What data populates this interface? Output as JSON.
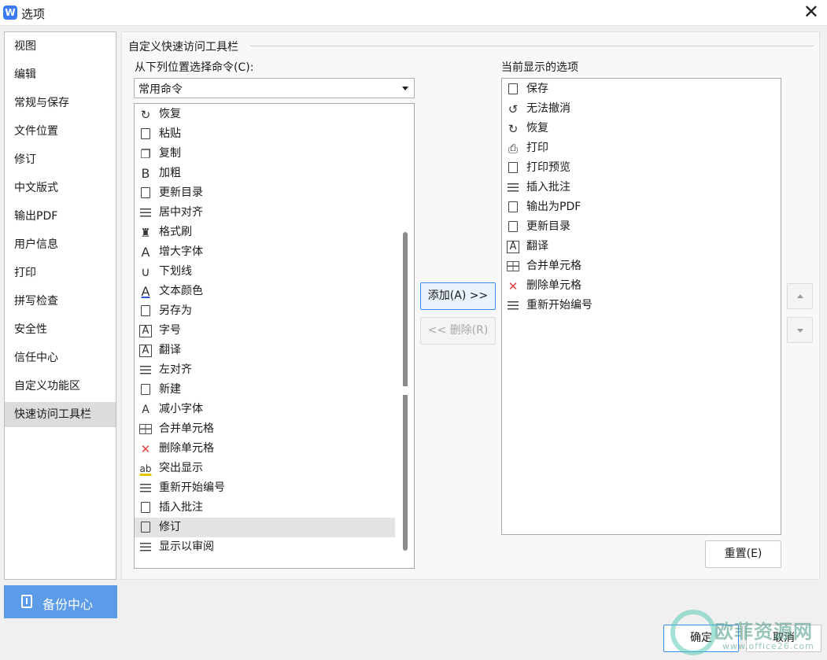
{
  "window": {
    "title": "选项",
    "app_icon_letter": "W",
    "close_glyph": "✕"
  },
  "sidebar": {
    "items": [
      {
        "label": "视图"
      },
      {
        "label": "编辑"
      },
      {
        "label": "常规与保存"
      },
      {
        "label": "文件位置"
      },
      {
        "label": "修订"
      },
      {
        "label": "中文版式"
      },
      {
        "label": "输出PDF"
      },
      {
        "label": "用户信息"
      },
      {
        "label": "打印"
      },
      {
        "label": "拼写检查"
      },
      {
        "label": "安全性"
      },
      {
        "label": "信任中心"
      },
      {
        "label": "自定义功能区"
      },
      {
        "label": "快速访问工具栏",
        "active": true
      }
    ],
    "backup_label": "备份中心",
    "backup_color": "#5b9be8"
  },
  "main": {
    "section_title": "自定义快速访问工具栏",
    "from_label": "从下列位置选择命令(C):",
    "combo_value": "常用命令",
    "current_label": "当前显示的选项",
    "available_commands": [
      {
        "label": "恢复",
        "icon": "redo-icon"
      },
      {
        "label": "粘贴",
        "icon": "paste-icon"
      },
      {
        "label": "复制",
        "icon": "copy-icon"
      },
      {
        "label": "加粗",
        "icon": "bold-icon"
      },
      {
        "label": "更新目录",
        "icon": "update-toc-icon"
      },
      {
        "label": "居中对齐",
        "icon": "align-center-icon"
      },
      {
        "label": "格式刷",
        "icon": "format-painter-icon"
      },
      {
        "label": "增大字体",
        "icon": "grow-font-icon"
      },
      {
        "label": "下划线",
        "icon": "underline-icon"
      },
      {
        "label": "文本颜色",
        "icon": "text-color-icon"
      },
      {
        "label": "另存为",
        "icon": "save-as-icon"
      },
      {
        "label": "字号",
        "icon": "font-size-icon"
      },
      {
        "label": "翻译",
        "icon": "translate-icon"
      },
      {
        "label": "左对齐",
        "icon": "align-left-icon"
      },
      {
        "label": "新建",
        "icon": "new-doc-icon"
      },
      {
        "label": "减小字体",
        "icon": "shrink-font-icon"
      },
      {
        "label": "合并单元格",
        "icon": "merge-cells-icon"
      },
      {
        "label": "删除单元格",
        "icon": "delete-cells-icon"
      },
      {
        "label": "突出显示",
        "icon": "highlight-icon"
      },
      {
        "label": "重新开始编号",
        "icon": "restart-numbering-icon"
      },
      {
        "label": "插入批注",
        "icon": "insert-comment-icon"
      },
      {
        "label": "修订",
        "icon": "track-changes-icon",
        "selected": true
      },
      {
        "label": "显示以审阅",
        "icon": "show-for-review-icon"
      }
    ],
    "current_commands": [
      {
        "label": "保存",
        "icon": "save-icon"
      },
      {
        "label": "无法撤消",
        "icon": "undo-icon"
      },
      {
        "label": "恢复",
        "icon": "redo-icon"
      },
      {
        "label": "打印",
        "icon": "print-icon"
      },
      {
        "label": "打印预览",
        "icon": "print-preview-icon"
      },
      {
        "label": "插入批注",
        "icon": "insert-comment-icon"
      },
      {
        "label": "输出为PDF",
        "icon": "export-pdf-icon"
      },
      {
        "label": "更新目录",
        "icon": "update-toc-icon"
      },
      {
        "label": "翻译",
        "icon": "translate-icon"
      },
      {
        "label": "合并单元格",
        "icon": "merge-cells-icon"
      },
      {
        "label": "删除单元格",
        "icon": "delete-cells-icon"
      },
      {
        "label": "重新开始编号",
        "icon": "restart-numbering-icon"
      }
    ],
    "add_label": "添加(A) >>",
    "remove_label": "<< 删除(R)",
    "reset_label": "重置(E)"
  },
  "footer": {
    "ok_label": "确定",
    "cancel_label": "取消"
  },
  "watermark": {
    "text": "欧菲资源网",
    "url": "www.office26.com"
  },
  "colors": {
    "accent": "#3b8cf0",
    "selection": "#e3e3e3"
  }
}
